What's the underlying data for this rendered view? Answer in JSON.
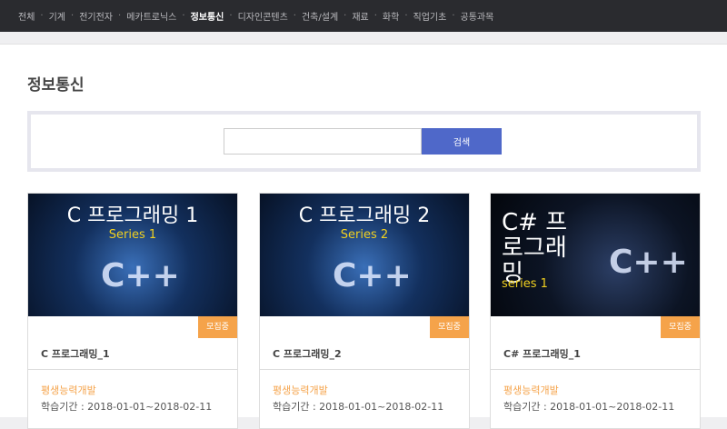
{
  "nav": {
    "items": [
      "전체",
      "기계",
      "전기전자",
      "메카트로닉스",
      "정보통신",
      "디자인콘텐츠",
      "건축/설계",
      "재료",
      "화학",
      "직업기초",
      "공통과목"
    ],
    "active": "정보통신"
  },
  "page_title": "정보통신",
  "search": {
    "value": "",
    "button": "검색"
  },
  "colors": {
    "accent": "#4f68c9",
    "badge": "#f5a34a"
  },
  "cards": [
    {
      "thumb_title": "C 프로그래밍 1",
      "thumb_series": "Series 1",
      "badge": "모집중",
      "title": "C 프로그래밍_1",
      "category": "평생능력개발",
      "period": "학습기간 : 2018-01-01~2018-02-11"
    },
    {
      "thumb_title": "C 프로그래밍 2",
      "thumb_series": "Series 2",
      "badge": "모집중",
      "title": "C 프로그래밍_2",
      "category": "평생능력개발",
      "period": "학습기간 : 2018-01-01~2018-02-11"
    },
    {
      "thumb_title": "C# 프로그래밍",
      "thumb_series": "series 1",
      "badge": "모집중",
      "title": "C# 프로그래밍_1",
      "category": "평생능력개발",
      "period": "학습기간 : 2018-01-01~2018-02-11"
    }
  ]
}
